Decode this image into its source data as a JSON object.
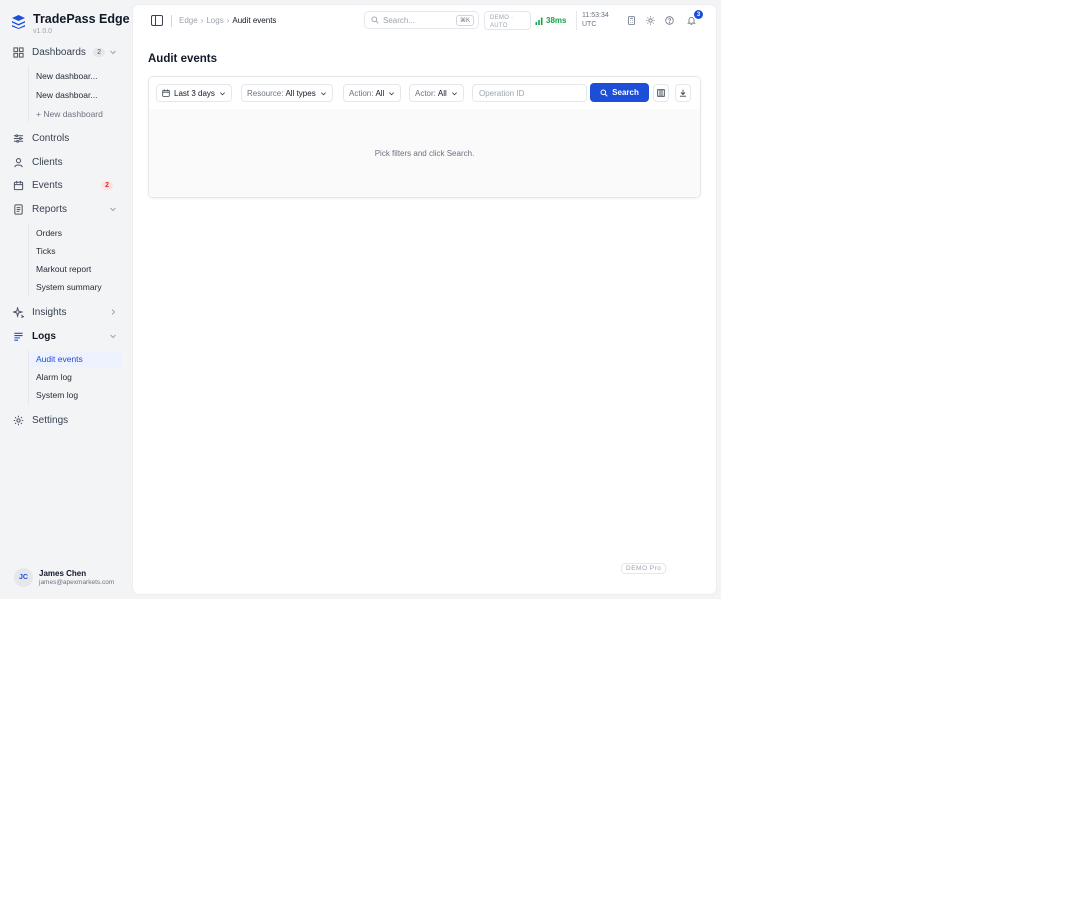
{
  "brand": {
    "name": "TradePass Edge",
    "version": "v1.0.0"
  },
  "sidebar": {
    "dashboards": {
      "label": "Dashboards",
      "badge": "2"
    },
    "dashboard_items": [
      "New dashboar...",
      "New dashboar...",
      "+ New dashboard"
    ],
    "controls": "Controls",
    "clients": "Clients",
    "events": {
      "label": "Events",
      "badge": "2"
    },
    "reports": {
      "label": "Reports",
      "items": [
        "Orders",
        "Ticks",
        "Markout report",
        "System summary"
      ]
    },
    "insights": "Insights",
    "logs": {
      "label": "Logs",
      "items": [
        "Audit events",
        "Alarm log",
        "System log"
      ]
    },
    "settings": "Settings"
  },
  "user": {
    "initials": "JC",
    "name": "James Chen",
    "email": "james@apexmarkets.com"
  },
  "topbar": {
    "breadcrumb": [
      "Edge",
      "Logs",
      "Audit events"
    ],
    "search_placeholder": "Search...",
    "search_shortcut": "⌘K",
    "mode_line1": "DEMO ·",
    "mode_line2": "AUTO",
    "latency": "38ms",
    "time": "11:53:34",
    "timezone": "UTC",
    "notification_count": "3"
  },
  "page": {
    "title": "Audit events"
  },
  "filters": {
    "range": "Last 3 days",
    "resource_label": "Resource:",
    "resource_value": "All types",
    "action_label": "Action:",
    "action_value": "All",
    "actor_label": "Actor:",
    "actor_value": "All",
    "operation_placeholder": "Operation ID",
    "search_button": "Search"
  },
  "empty_state": "Pick filters and click Search.",
  "footer_badge": "DEMO Pro",
  "colors": {
    "accent": "#1d4ed8",
    "latency": "#16a34a",
    "badge_red": "#dc2626"
  }
}
